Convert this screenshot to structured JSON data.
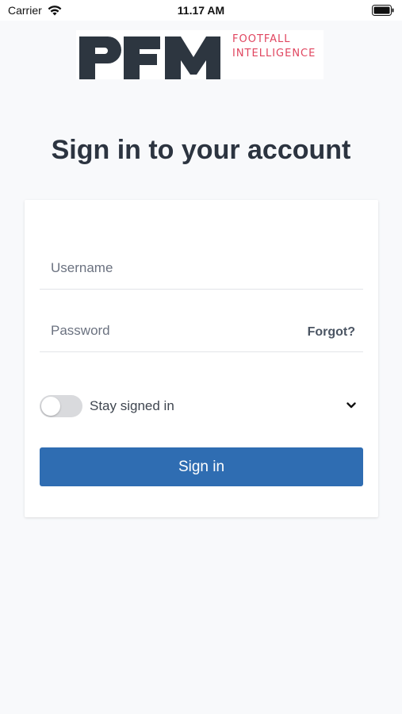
{
  "status_bar": {
    "carrier": "Carrier",
    "time": "11.17 AM"
  },
  "logo": {
    "mark": "PFM",
    "line1": "FOOTFALL",
    "line2": "INTELLIGENCE",
    "accent_color": "#e0455f",
    "mark_color": "#2d3640"
  },
  "page": {
    "title": "Sign in to your account"
  },
  "form": {
    "username_placeholder": "Username",
    "password_placeholder": "Password",
    "forgot_label": "Forgot?",
    "stay_signed_in_label": "Stay signed in",
    "stay_signed_in_on": false,
    "submit_label": "Sign in",
    "button_color": "#2f6db2"
  },
  "icons": {
    "wifi": "wifi-icon",
    "battery": "battery-icon",
    "chevron": "chevron-down-icon"
  }
}
